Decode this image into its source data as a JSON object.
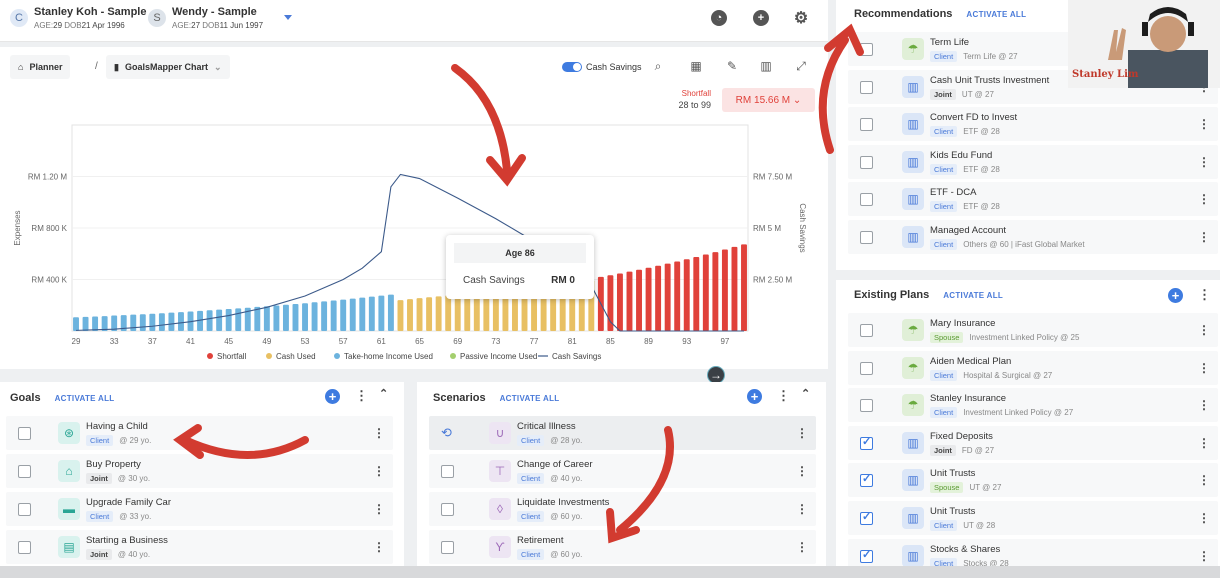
{
  "clients": [
    {
      "initial": "C",
      "name": "Stanley Koh - Sample",
      "age_label": "AGE:",
      "age": "29",
      "dob_label": "DOB",
      "dob": "21 Apr 1996"
    },
    {
      "initial": "S",
      "name": "Wendy - Sample",
      "age_label": "AGE:",
      "age": "27",
      "dob_label": "DOB",
      "dob": "11 Jun 1997"
    }
  ],
  "header_icons": [
    "pie-chart-icon",
    "add-icon",
    "settings-icon"
  ],
  "breadcrumb": {
    "home": "Planner",
    "chart": "GoalsMapper Chart"
  },
  "toolbar": {
    "toggle_label": "Cash Savings"
  },
  "shortfall": {
    "label": "Shortfall",
    "range": "28 to 99",
    "amount": "RM 15.66 M"
  },
  "chart_data": {
    "type": "bar",
    "x_ticks": [
      "29",
      "33",
      "37",
      "41",
      "45",
      "49",
      "53",
      "57",
      "61",
      "65",
      "69",
      "73",
      "77",
      "81",
      "85",
      "89",
      "93",
      "97"
    ],
    "y_left_label": "Expenses",
    "y_left_ticks": [
      "RM 400 K",
      "RM 800 K",
      "RM 1.20 M"
    ],
    "y_right_label": "Cash Savings",
    "y_right_ticks": [
      "RM 2.50 M",
      "RM 5 M",
      "RM 7.50 M"
    ],
    "y_right_range": [
      0,
      10000000
    ],
    "y_left_range": [
      0,
      1600000
    ],
    "series": [
      {
        "name": "Shortfall",
        "color": "#e0413a",
        "ages": [
          84,
          99
        ],
        "start": 1250000,
        "end": 3630000,
        "overlap": "ages 82-84 within the red phase"
      },
      {
        "name": "Cash Used",
        "color": "#e8c063",
        "ages": [
          63,
          83
        ]
      },
      {
        "name": "Take-home Income Used",
        "color": "#6cb3de",
        "ages": [
          29,
          62
        ]
      },
      {
        "name": "Passive Income Used",
        "color": "#a4cf6e",
        "ages": []
      },
      {
        "name": "Cash Savings",
        "color": "#3c5a8a",
        "type": "line"
      }
    ],
    "bars": [
      {
        "age": 29,
        "value": 107000
      },
      {
        "age": 30,
        "value": 110000
      },
      {
        "age": 31,
        "value": 113000
      },
      {
        "age": 32,
        "value": 116000
      },
      {
        "age": 33,
        "value": 120000
      },
      {
        "age": 34,
        "value": 123000
      },
      {
        "age": 35,
        "value": 127000
      },
      {
        "age": 36,
        "value": 130000
      },
      {
        "age": 37,
        "value": 134000
      },
      {
        "age": 38,
        "value": 138000
      },
      {
        "age": 39,
        "value": 143000
      },
      {
        "age": 40,
        "value": 147000
      },
      {
        "age": 41,
        "value": 151000
      },
      {
        "age": 42,
        "value": 156000
      },
      {
        "age": 43,
        "value": 161000
      },
      {
        "age": 44,
        "value": 166000
      },
      {
        "age": 45,
        "value": 171000
      },
      {
        "age": 46,
        "value": 176000
      },
      {
        "age": 47,
        "value": 181000
      },
      {
        "age": 48,
        "value": 187000
      },
      {
        "age": 49,
        "value": 192000
      },
      {
        "age": 50,
        "value": 198000
      },
      {
        "age": 51,
        "value": 204000
      },
      {
        "age": 52,
        "value": 210000
      },
      {
        "age": 53,
        "value": 216000
      },
      {
        "age": 54,
        "value": 223000
      },
      {
        "age": 55,
        "value": 230000
      },
      {
        "age": 56,
        "value": 237000
      },
      {
        "age": 57,
        "value": 244000
      },
      {
        "age": 58,
        "value": 251000
      },
      {
        "age": 59,
        "value": 259000
      },
      {
        "age": 60,
        "value": 267000
      },
      {
        "age": 61,
        "value": 275000
      },
      {
        "age": 62,
        "value": 283000
      },
      {
        "age": 63,
        "value": 240000
      },
      {
        "age": 64,
        "value": 248000
      },
      {
        "age": 65,
        "value": 255000
      },
      {
        "age": 66,
        "value": 262000
      },
      {
        "age": 67,
        "value": 269000
      },
      {
        "age": 68,
        "value": 276000
      },
      {
        "age": 69,
        "value": 283000
      },
      {
        "age": 70,
        "value": 290000
      },
      {
        "age": 71,
        "value": 297000
      },
      {
        "age": 72,
        "value": 304000
      },
      {
        "age": 73,
        "value": 311000
      },
      {
        "age": 74,
        "value": 318000
      },
      {
        "age": 75,
        "value": 326000
      },
      {
        "age": 76,
        "value": 334000
      },
      {
        "age": 77,
        "value": 342000
      },
      {
        "age": 78,
        "value": 350000
      },
      {
        "age": 79,
        "value": 358000
      },
      {
        "age": 80,
        "value": 367000
      },
      {
        "age": 81,
        "value": 376000
      },
      {
        "age": 82,
        "value": 385000
      },
      {
        "age": 83,
        "value": 395000
      },
      {
        "age": 84,
        "value": 420000
      },
      {
        "age": 85,
        "value": 433000
      },
      {
        "age": 86,
        "value": 447000
      },
      {
        "age": 87,
        "value": 461000
      },
      {
        "age": 88,
        "value": 476000
      },
      {
        "age": 89,
        "value": 491000
      },
      {
        "age": 90,
        "value": 507000
      },
      {
        "age": 91,
        "value": 523000
      },
      {
        "age": 92,
        "value": 540000
      },
      {
        "age": 93,
        "value": 557000
      },
      {
        "age": 94,
        "value": 575000
      },
      {
        "age": 95,
        "value": 594000
      },
      {
        "age": 96,
        "value": 613000
      },
      {
        "age": 97,
        "value": 633000
      },
      {
        "age": 98,
        "value": 653000
      },
      {
        "age": 99,
        "value": 673000
      }
    ],
    "cash_savings_line": [
      {
        "age": 29,
        "value": 30000
      },
      {
        "age": 33,
        "value": 90000
      },
      {
        "age": 37,
        "value": 230000
      },
      {
        "age": 41,
        "value": 450000
      },
      {
        "age": 45,
        "value": 750000
      },
      {
        "age": 49,
        "value": 1150000
      },
      {
        "age": 53,
        "value": 1700000
      },
      {
        "age": 57,
        "value": 2500000
      },
      {
        "age": 59,
        "value": 3050000
      },
      {
        "age": 61,
        "value": 3850000
      },
      {
        "age": 62,
        "value": 7000000
      },
      {
        "age": 63,
        "value": 7600000
      },
      {
        "age": 65,
        "value": 7400000
      },
      {
        "age": 69,
        "value": 6450000
      },
      {
        "age": 73,
        "value": 5450000
      },
      {
        "age": 77,
        "value": 4350000
      },
      {
        "age": 81,
        "value": 3150000
      },
      {
        "age": 83,
        "value": 2200000
      },
      {
        "age": 85,
        "value": 450000
      },
      {
        "age": 86,
        "value": 0
      },
      {
        "age": 99,
        "value": 0
      }
    ],
    "tooltip": {
      "title": "Age 86",
      "label": "Cash Savings",
      "value": "RM 0"
    },
    "legend": [
      "Shortfall",
      "Cash Used",
      "Take-home Income Used",
      "Passive Income Used",
      "Cash Savings"
    ]
  },
  "goals": {
    "title": "Goals",
    "activate": "ACTIVATE ALL",
    "items": [
      {
        "title": "Having a Child",
        "tag": "Client",
        "sub": "@ 29 yo.",
        "icon": "stroller-icon",
        "style": "teal"
      },
      {
        "title": "Buy Property",
        "tag": "Joint",
        "sub": "@ 30 yo.",
        "icon": "house-icon",
        "style": "teal"
      },
      {
        "title": "Upgrade Family Car",
        "tag": "Client",
        "sub": "@ 33 yo.",
        "icon": "car-icon",
        "style": "teal"
      },
      {
        "title": "Starting a Business",
        "tag": "Joint",
        "sub": "@ 40 yo.",
        "icon": "store-icon",
        "style": "teal"
      }
    ]
  },
  "scenarios": {
    "title": "Scenarios",
    "activate": "ACTIVATE ALL",
    "items": [
      {
        "title": "Critical Illness",
        "tag": "Client",
        "sub": "@ 28 yo.",
        "icon": "stethoscope-icon",
        "style": "purple"
      },
      {
        "title": "Change of Career",
        "tag": "Client",
        "sub": "@ 40 yo.",
        "icon": "signpost-icon",
        "style": "purple"
      },
      {
        "title": "Liquidate Investments",
        "tag": "Client",
        "sub": "@ 60 yo.",
        "icon": "drop-icon",
        "style": "purple"
      },
      {
        "title": "Retirement",
        "tag": "Client",
        "sub": "@ 60 yo.",
        "icon": "palm-tree-icon",
        "style": "purple"
      }
    ]
  },
  "recommendations": {
    "title": "Recommendations",
    "activate": "ACTIVATE ALL",
    "items": [
      {
        "title": "Term Life",
        "tag": "Client",
        "sub": "Term Life @ 27",
        "icon": "umbrella-icon",
        "style": "green",
        "checked": false
      },
      {
        "title": "Cash Unit Trusts Investment",
        "tag": "Joint",
        "sub": "UT @ 27",
        "icon": "chart-icon",
        "style": "blue",
        "checked": false
      },
      {
        "title": "Convert FD to Invest",
        "tag": "Client",
        "sub": "ETF @ 28",
        "icon": "chart-icon",
        "style": "blue",
        "checked": false
      },
      {
        "title": "Kids Edu Fund",
        "tag": "Client",
        "sub": "ETF @ 28",
        "icon": "chart-icon",
        "style": "blue",
        "checked": false
      },
      {
        "title": "ETF - DCA",
        "tag": "Client",
        "sub": "ETF @ 28",
        "icon": "chart-icon",
        "style": "blue",
        "checked": false
      },
      {
        "title": "Managed Account",
        "tag": "Client",
        "sub": "Others @ 60 | iFast Global Market",
        "icon": "chart-icon",
        "style": "blue",
        "checked": false
      }
    ]
  },
  "existing": {
    "title": "Existing Plans",
    "activate": "ACTIVATE ALL",
    "items": [
      {
        "title": "Mary Insurance",
        "tag": "Spouse",
        "sub": "Investment Linked Policy @ 25",
        "icon": "umbrella-icon",
        "style": "green",
        "checked": false
      },
      {
        "title": "Aiden Medical Plan",
        "tag": "Client",
        "sub": "Hospital & Surgical @ 27",
        "icon": "umbrella-icon",
        "style": "green",
        "checked": false
      },
      {
        "title": "Stanley Insurance",
        "tag": "Client",
        "sub": "Investment Linked Policy @ 27",
        "icon": "umbrella-icon",
        "style": "green",
        "checked": false
      },
      {
        "title": "Fixed Deposits",
        "tag": "Joint",
        "sub": "FD @ 27",
        "icon": "chart-icon",
        "style": "blue",
        "checked": true
      },
      {
        "title": "Unit Trusts",
        "tag": "Spouse",
        "sub": "UT @ 27",
        "icon": "chart-icon",
        "style": "blue",
        "checked": true
      },
      {
        "title": "Unit Trusts",
        "tag": "Client",
        "sub": "UT @ 28",
        "icon": "chart-icon",
        "style": "blue",
        "checked": true
      },
      {
        "title": "Stocks & Shares",
        "tag": "Client",
        "sub": "Stocks @ 28",
        "icon": "chart-icon",
        "style": "blue",
        "checked": true
      }
    ]
  },
  "webcam": {
    "name": "Stanley Lim"
  }
}
